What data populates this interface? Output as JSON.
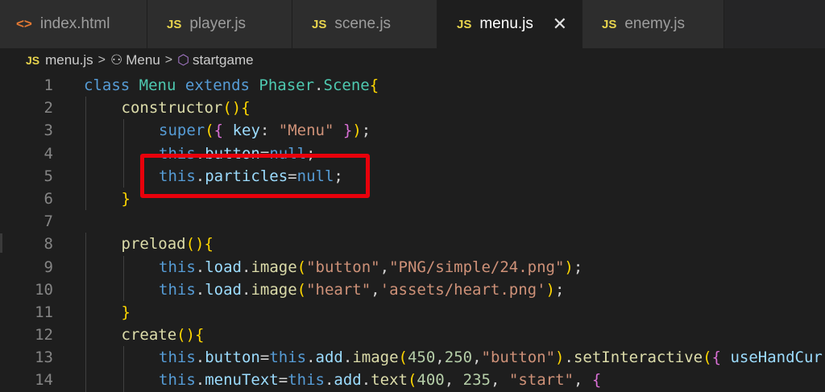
{
  "tabs": [
    {
      "icon": "<>",
      "label": "index.html"
    },
    {
      "icon": "JS",
      "label": "player.js"
    },
    {
      "icon": "JS",
      "label": "scene.js"
    },
    {
      "icon": "JS",
      "label": "menu.js",
      "close": "✕"
    },
    {
      "icon": "JS",
      "label": "enemy.js"
    }
  ],
  "breadcrumb": {
    "file_icon": "JS",
    "file": "menu.js",
    "sep": ">",
    "class_icon": "⚇",
    "class": "Menu",
    "method_icon": "⬡",
    "method": "startgame"
  },
  "code_lines": [
    {
      "n": "1",
      "t": "class Menu extends Phaser.Scene{"
    },
    {
      "n": "2",
      "t": "constructor(){"
    },
    {
      "n": "3",
      "t": "super({ key: \"Menu\" });"
    },
    {
      "n": "4",
      "t": "this.button=null;"
    },
    {
      "n": "5",
      "t": "this.particles=null;"
    },
    {
      "n": "6",
      "t": "}"
    },
    {
      "n": "7",
      "t": ""
    },
    {
      "n": "8",
      "t": "preload(){"
    },
    {
      "n": "9",
      "t": "this.load.image(\"button\",\"PNG/simple/24.png\");"
    },
    {
      "n": "10",
      "t": "this.load.image(\"heart\",'assets/heart.png');"
    },
    {
      "n": "11",
      "t": "}"
    },
    {
      "n": "12",
      "t": "create(){"
    },
    {
      "n": "13",
      "t": "this.button=this.add.image(450,250,\"button\").setInteractive({ useHandCur"
    },
    {
      "n": "14",
      "t": "this.menuText=this.add.text(400, 235, \"start\", {"
    }
  ],
  "highlight_color": "#e8000b"
}
